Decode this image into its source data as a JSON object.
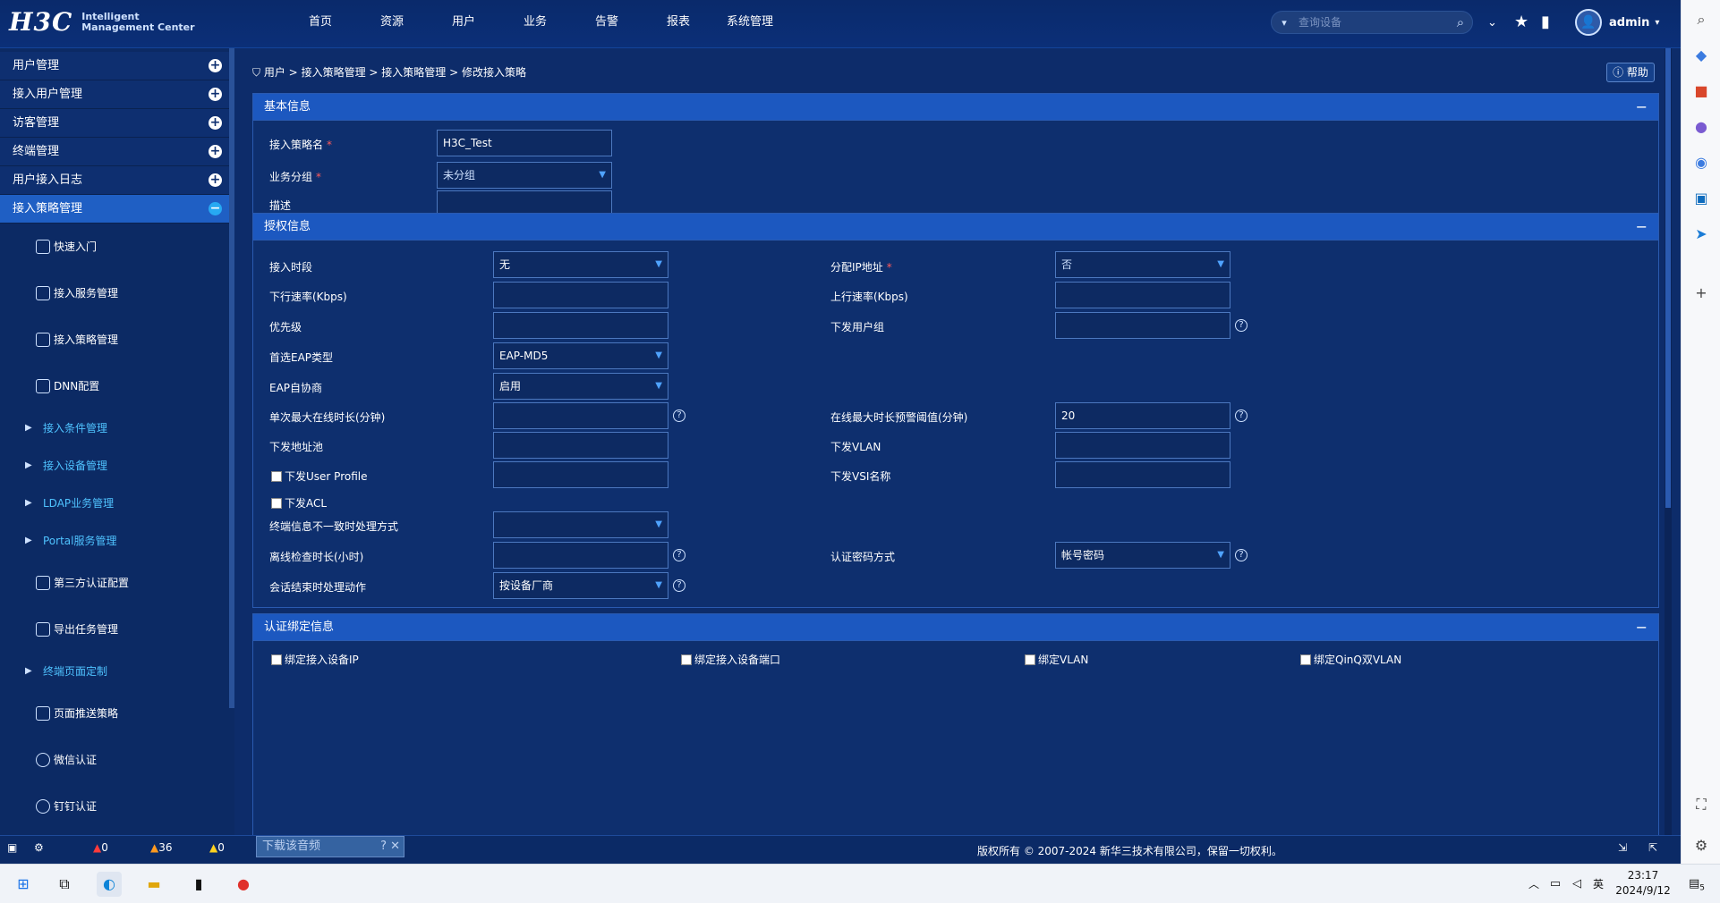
{
  "header": {
    "logo_main": "H3C",
    "logo_line1": "Intelligent",
    "logo_line2": "Management Center",
    "nav": [
      "首页",
      "资源",
      "用户",
      "业务",
      "告警",
      "报表",
      "系统管理"
    ],
    "search_placeholder": "查询设备",
    "user": "admin"
  },
  "sidebar": {
    "main_items": [
      {
        "label": "用户管理"
      },
      {
        "label": "接入用户管理"
      },
      {
        "label": "访客管理"
      },
      {
        "label": "终端管理"
      },
      {
        "label": "用户接入日志"
      },
      {
        "label": "接入策略管理",
        "active": true
      }
    ],
    "sub_items": [
      {
        "label": "快速入门",
        "icon": "quickstart-icon"
      },
      {
        "label": "接入服务管理",
        "icon": "service-icon"
      },
      {
        "label": "接入策略管理",
        "icon": "policy-icon"
      },
      {
        "label": "DNN配置",
        "icon": "dnn-icon"
      }
    ],
    "folders": [
      "接入条件管理",
      "接入设备管理",
      "LDAP业务管理",
      "Portal服务管理"
    ],
    "sub_items2": [
      {
        "label": "第三方认证配置",
        "icon": "third-party-icon"
      },
      {
        "label": "导出任务管理",
        "icon": "export-icon"
      }
    ],
    "folder2": "终端页面定制",
    "sub_items3": [
      {
        "label": "页面推送策略",
        "icon": "push-icon"
      },
      {
        "label": "微信认证",
        "icon": "wechat-icon"
      },
      {
        "label": "钉钉认证",
        "icon": "dingtalk-icon"
      }
    ]
  },
  "breadcrumb": {
    "items": [
      "用户",
      "接入策略管理",
      "接入策略管理",
      "修改接入策略"
    ],
    "sep": ">",
    "help": "帮助"
  },
  "basic": {
    "title": "基本信息",
    "name_label": "接入策略名",
    "name_value": "H3C_Test",
    "group_label": "业务分组",
    "group_value": "未分组",
    "desc_label": "描述",
    "desc_value": ""
  },
  "auth": {
    "title": "授权信息",
    "left": [
      {
        "label": "接入时段",
        "value": "无",
        "type": "select"
      },
      {
        "label": "下行速率(Kbps)",
        "value": "",
        "type": "input"
      },
      {
        "label": "优先级",
        "value": "",
        "type": "input"
      },
      {
        "label": "首选EAP类型",
        "value": "EAP-MD5",
        "type": "select"
      },
      {
        "label": "EAP自协商",
        "value": "启用",
        "type": "select"
      },
      {
        "label": "单次最大在线时长(分钟)",
        "value": "",
        "type": "input"
      },
      {
        "label": "下发地址池",
        "value": "",
        "type": "input"
      },
      {
        "label": "下发User Profile",
        "value": "",
        "type": "input"
      },
      {
        "label": "下发ACL",
        "value": "",
        "type": "none"
      },
      {
        "label": "终端信息不一致时处理方式",
        "value": "",
        "type": "select"
      },
      {
        "label": "离线检查时长(小时)",
        "value": "",
        "type": "input"
      },
      {
        "label": "会话结束时处理动作",
        "value": "按设备厂商",
        "type": "select"
      }
    ],
    "right": [
      {
        "label": "分配IP地址",
        "value": "否",
        "type": "select"
      },
      {
        "label": "上行速率(Kbps)",
        "value": "",
        "type": "input"
      },
      {
        "label": "下发用户组",
        "value": "",
        "type": "input"
      },
      {
        "label": "在线最大时长预警阈值(分钟)",
        "value": "20",
        "type": "input"
      },
      {
        "label": "下发VLAN",
        "value": "",
        "type": "input"
      },
      {
        "label": "下发VSI名称",
        "value": "",
        "type": "input"
      },
      {
        "label": "认证密码方式",
        "value": "帐号密码",
        "type": "select"
      }
    ]
  },
  "binding": {
    "title": "认证绑定信息",
    "items": [
      "绑定接入设备IP",
      "绑定接入设备端口",
      "绑定VLAN",
      "绑定QinQ双VLAN"
    ]
  },
  "footer": {
    "alarm_red": "0",
    "alarm_orange": "36",
    "alarm_yellow": "0",
    "video": "下载该音频",
    "copyright": "版权所有 © 2007-2024 新华三技术有限公司，保留一切权利。"
  },
  "taskbar": {
    "time": "23:17",
    "date": "2024/9/12",
    "lang": "英",
    "notif": "5"
  },
  "colors": {
    "accent": "#1c58c0",
    "bg": "#0d2c6a",
    "required": "#ff5a5a"
  }
}
